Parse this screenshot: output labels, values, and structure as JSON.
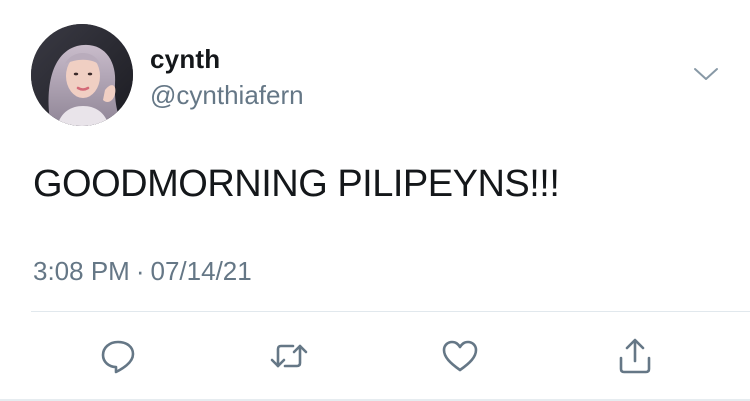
{
  "tweet": {
    "author": {
      "display_name": "cynth",
      "handle": "@cynthiafern"
    },
    "text": "GOODMORNING PILIPEYNS!!!",
    "time": "3:08 PM",
    "separator": "·",
    "date": "07/14/21"
  },
  "icons": {
    "menu": "chevron-down-icon",
    "reply": "reply-icon",
    "retweet": "retweet-icon",
    "like": "heart-icon",
    "share": "share-icon"
  },
  "colors": {
    "icon": "#657786",
    "text": "#14171a",
    "secondary": "#657786"
  }
}
